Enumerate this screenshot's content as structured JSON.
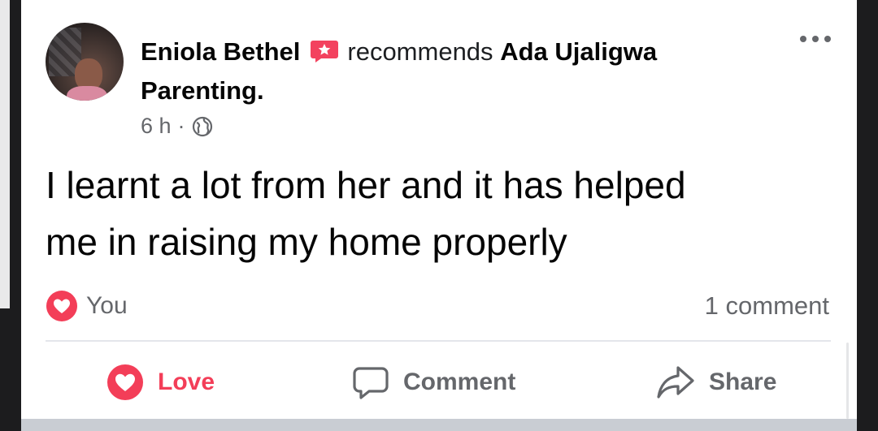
{
  "post": {
    "author": "Eniola Bethel",
    "action_text": "recommends",
    "page_name_line1": "Ada Ujaligwa",
    "page_name_line2": "Parenting.",
    "time": "6 h",
    "separator": "·",
    "privacy_icon": "globe-icon",
    "body_line1": "I learnt a lot from her and it has helped",
    "body_line2": "me in raising my home properly"
  },
  "reactions": {
    "who": "You",
    "icon": "heart-icon",
    "comments_count": "1 comment"
  },
  "actions": {
    "love_label": "Love",
    "comment_label": "Comment",
    "share_label": "Share"
  },
  "colors": {
    "love": "#f33e58",
    "recommend_badge": "#f3425f",
    "muted_text": "#65676b",
    "text": "#050505"
  }
}
